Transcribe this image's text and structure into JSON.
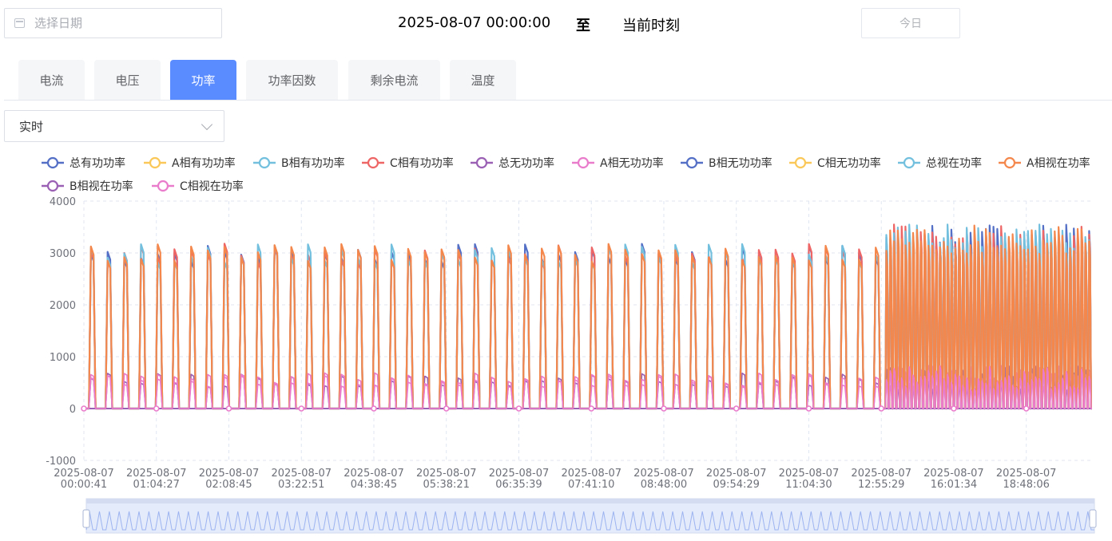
{
  "date_picker": {
    "placeholder": "选择日期"
  },
  "range": {
    "start": "2025-08-07 00:00:00",
    "separator": "至",
    "end": "当前时刻"
  },
  "today_button": "今日",
  "tabs": [
    {
      "label": "电流",
      "active": false
    },
    {
      "label": "电压",
      "active": false
    },
    {
      "label": "功率",
      "active": true
    },
    {
      "label": "功率因数",
      "active": false
    },
    {
      "label": "剩余电流",
      "active": false
    },
    {
      "label": "温度",
      "active": false
    }
  ],
  "mode_select": {
    "value": "实时"
  },
  "colors": {
    "accent": "#5b8cff",
    "series": [
      "#5470c6",
      "#fac858",
      "#73c0de",
      "#ee6666",
      "#9a60b4",
      "#ea7ccc",
      "#5470c6",
      "#fac858",
      "#73c0de",
      "#f4874b",
      "#9a60b4",
      "#ea7ccc"
    ]
  },
  "chart_data": {
    "type": "line",
    "series": [
      {
        "name": "总有功功率"
      },
      {
        "name": "A相有功功率"
      },
      {
        "name": "B相有功功率"
      },
      {
        "name": "C相有功功率"
      },
      {
        "name": "总无功功率"
      },
      {
        "name": "A相无功功率"
      },
      {
        "name": "B相无功功率"
      },
      {
        "name": "C相无功功率"
      },
      {
        "name": "总视在功率"
      },
      {
        "name": "A相视在功率"
      },
      {
        "name": "B相视在功率"
      },
      {
        "name": "C相视在功率"
      }
    ],
    "ylim": [
      -1000,
      4000
    ],
    "yticks": [
      "4000",
      "3000",
      "2000",
      "1000",
      "0",
      "-1000"
    ],
    "xticks": [
      {
        "date": "2025-08-07",
        "time": "00:00:41"
      },
      {
        "date": "2025-08-07",
        "time": "01:04:27"
      },
      {
        "date": "2025-08-07",
        "time": "02:08:45"
      },
      {
        "date": "2025-08-07",
        "time": "03:22:51"
      },
      {
        "date": "2025-08-07",
        "time": "04:38:45"
      },
      {
        "date": "2025-08-07",
        "time": "05:38:21"
      },
      {
        "date": "2025-08-07",
        "time": "06:35:39"
      },
      {
        "date": "2025-08-07",
        "time": "07:41:10"
      },
      {
        "date": "2025-08-07",
        "time": "08:48:00"
      },
      {
        "date": "2025-08-07",
        "time": "09:54:29"
      },
      {
        "date": "2025-08-07",
        "time": "11:04:30"
      },
      {
        "date": "2025-08-07",
        "time": "12:55:29"
      },
      {
        "date": "2025-08-07",
        "time": "16:01:34"
      },
      {
        "date": "2025-08-07",
        "time": "18:48:06"
      }
    ],
    "grid": true,
    "legend_position": "top",
    "pulse_pattern": {
      "early_pulse_count": 48,
      "early_peak": 3000,
      "late_pulse_count": 54,
      "late_peak": 3300,
      "reactive_peak": 550,
      "baseline": 0
    },
    "dataZoom": {
      "start": 0,
      "end": 100
    }
  }
}
